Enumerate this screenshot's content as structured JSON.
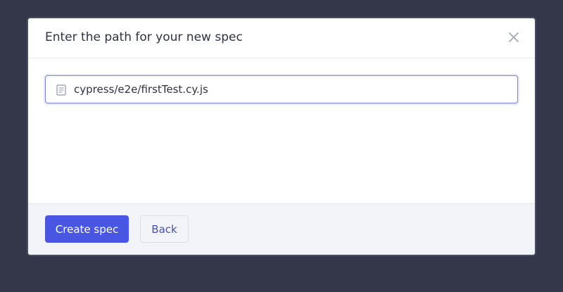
{
  "modal": {
    "title": "Enter the path for your new spec",
    "close_icon": "close-icon",
    "path_input": {
      "icon": "document-icon",
      "value": "cypress/e2e/firstTest.cy.js"
    },
    "footer": {
      "create_label": "Create spec",
      "back_label": "Back"
    }
  },
  "colors": {
    "backdrop": "#333749",
    "primary": "#4956e3",
    "input_focus_border": "#7d84e0",
    "footer_bg": "#f3f4fa",
    "secondary_text": "#4650a8"
  }
}
